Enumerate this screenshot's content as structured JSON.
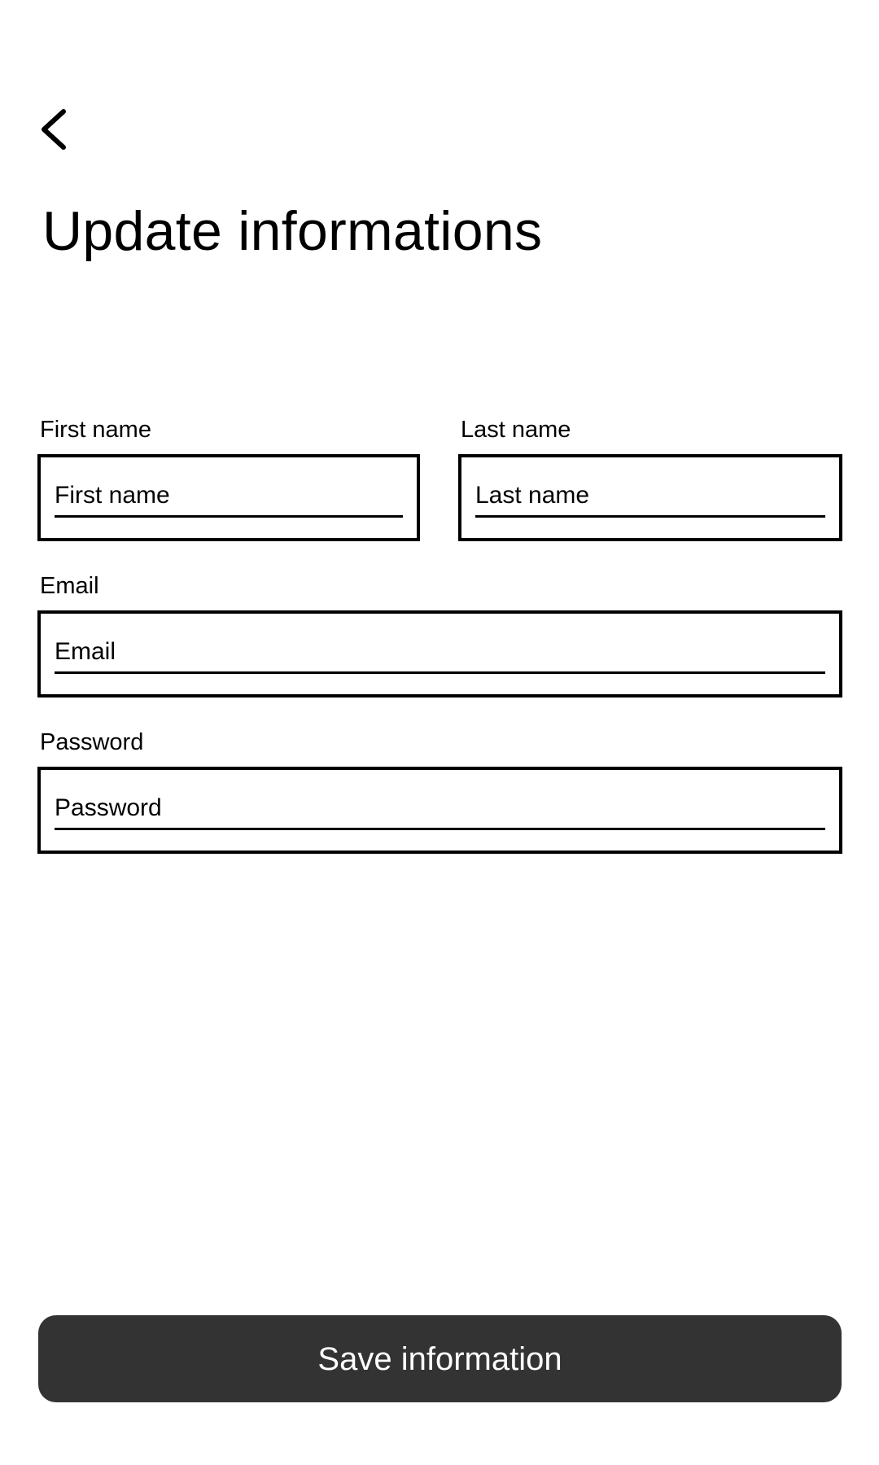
{
  "header": {
    "back_icon": "chevron-left-icon",
    "title": "Update informations"
  },
  "form": {
    "first_name": {
      "label": "First name",
      "placeholder": "First name",
      "value": ""
    },
    "last_name": {
      "label": "Last name",
      "placeholder": "Last name",
      "value": ""
    },
    "email": {
      "label": "Email",
      "placeholder": "Email",
      "value": ""
    },
    "password": {
      "label": "Password",
      "placeholder": "Password",
      "value": ""
    }
  },
  "actions": {
    "save_label": "Save information"
  },
  "colors": {
    "background": "#ffffff",
    "text": "#000000",
    "button_background": "#333333",
    "button_text": "#ffffff"
  }
}
